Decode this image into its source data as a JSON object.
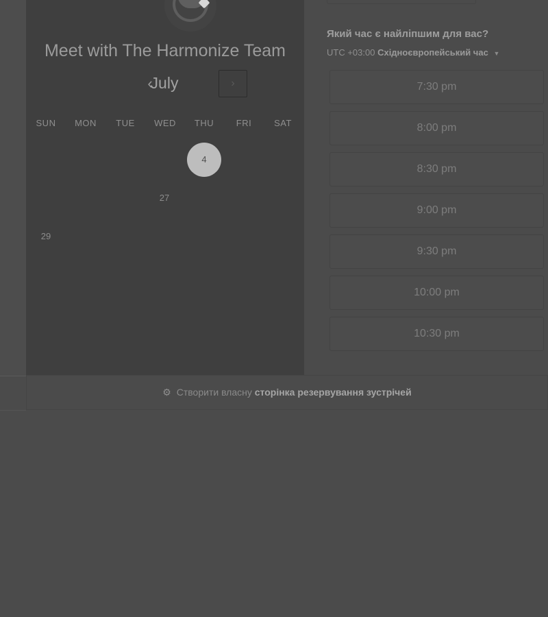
{
  "booking": {
    "org_title": "Meet with The Harmonize Team",
    "month": "July",
    "prev_symbol": "‹",
    "next_symbol": "›",
    "weekdays": [
      "SUN",
      "MON",
      "TUE",
      "WED",
      "THU",
      "FRI",
      "SAT"
    ],
    "days": [
      {
        "label": "4",
        "selected": true
      },
      {
        "label": "27",
        "selected": false
      },
      {
        "label": "29",
        "selected": false
      }
    ]
  },
  "times": {
    "question": "Який час є найліпшим для вас?",
    "tz_offset": "UTC +03:00",
    "tz_name": "Східноєвропейський час",
    "slots": [
      "7:30 pm",
      "8:00 pm",
      "8:30 pm",
      "9:00 pm",
      "9:30 pm",
      "10:00 pm",
      "10:30 pm"
    ]
  },
  "footer": {
    "prefix": "Створити власну",
    "link": "сторінка резервування зустрічей"
  },
  "icons": {
    "avatar": "chat-bubble-icon",
    "prev": "chevron-left-icon",
    "next": "chevron-right-icon",
    "tz": "caret-down-icon",
    "footer": "hubspot-sprocket-icon"
  }
}
